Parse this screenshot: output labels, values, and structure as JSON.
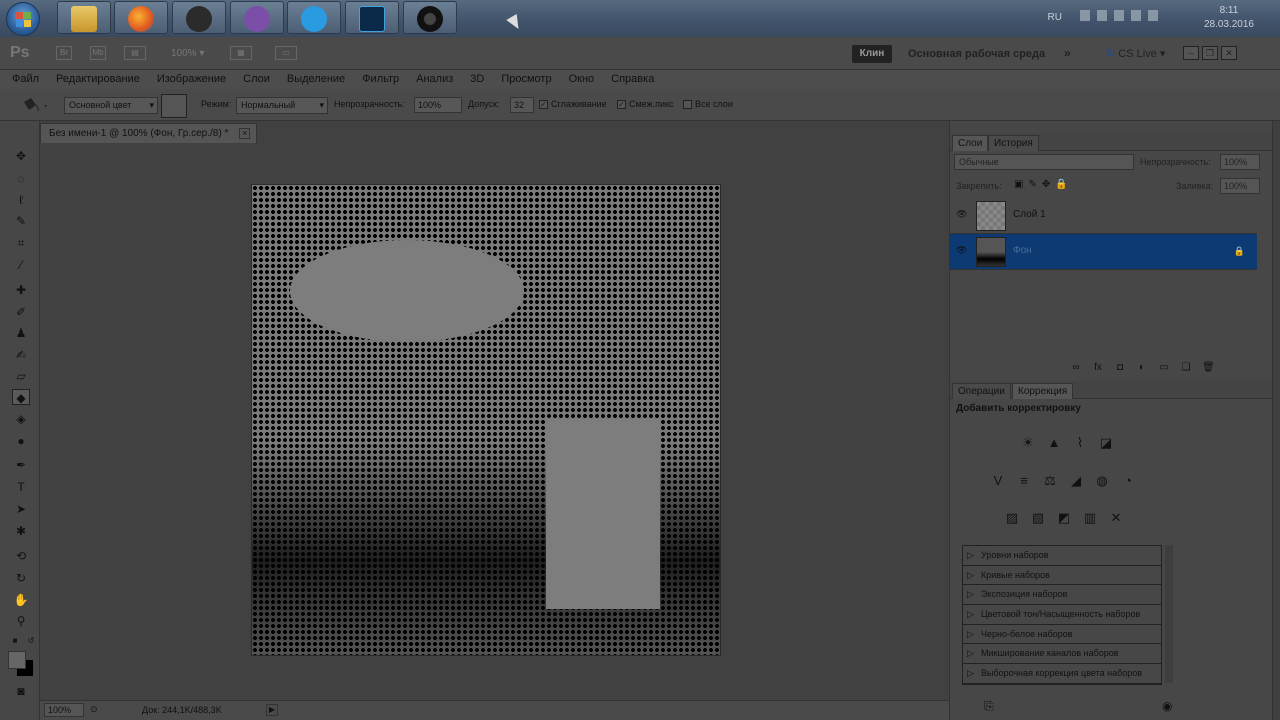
{
  "taskbar": {
    "language": "RU",
    "time": "8:11",
    "date": "28.03.2016",
    "apps": [
      "explorer-folder-icon",
      "firefox-icon",
      "telegram-icon",
      "viber-icon",
      "skype-icon",
      "photoshop-icon",
      "obs-icon"
    ]
  },
  "appbar": {
    "zoom": "100%",
    "workspace_button": "Клин",
    "workspace_name": "Основная рабочая среда",
    "more": "»",
    "cslive": "CS Live"
  },
  "menu": [
    "Файл",
    "Редактирование",
    "Изображение",
    "Слои",
    "Выделение",
    "Фильтр",
    "Анализ",
    "3D",
    "Просмотр",
    "Окно",
    "Справка"
  ],
  "options": {
    "fill_source": "Основной цвет",
    "mode_label": "Режим:",
    "mode_value": "Нормальный",
    "opacity_label": "Непрозрачность:",
    "opacity_value": "100%",
    "tolerance_label": "Допуск:",
    "tolerance_value": "32",
    "antialias_label": "Сглаживание",
    "contiguous_label": "Смеж.пикс",
    "all_layers_label": "Все слои"
  },
  "document": {
    "tab_title": "Без имени-1 @ 100% (Фон, Гр.сер./8) *",
    "close": "×"
  },
  "status": {
    "zoom": "100%",
    "doc_info": "Док: 244,1K/488,3K"
  },
  "layers_panel": {
    "tab_layers": "Слои",
    "tab_history": "История",
    "blend_mode": "Обычные",
    "opacity_label": "Непрозрачность:",
    "opacity_value": "100%",
    "lock_label": "Закрепить:",
    "fill_label": "Заливка:",
    "fill_value": "100%",
    "layers": [
      {
        "name": "Слой 1",
        "selected": false
      },
      {
        "name": "Фон",
        "selected": true
      }
    ]
  },
  "adjustments_panel": {
    "tab_actions": "Операции",
    "tab_adjustments": "Коррекция",
    "title": "Добавить корректировку",
    "presets": [
      "Уровни наборов",
      "Кривые наборов",
      "Экспозиция наборов",
      "Цветовой тон/Насыщенность наборов",
      "Черно-белое наборов",
      "Микширование каналов наборов",
      "Выборочная коррекция цвета наборов"
    ]
  },
  "colors": {
    "selected_layer": "#0d3a73",
    "foreground": "#666666",
    "background": "#000000"
  }
}
